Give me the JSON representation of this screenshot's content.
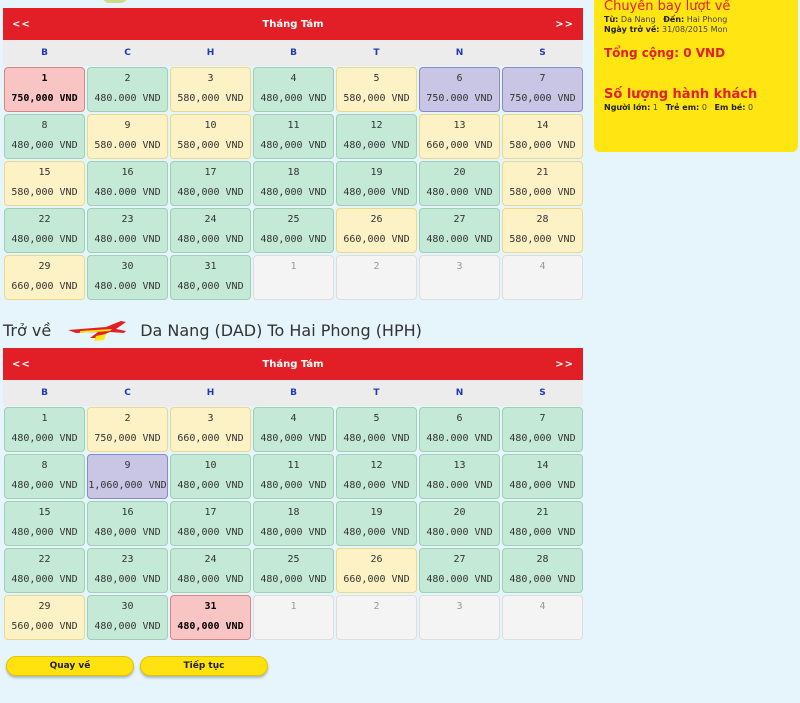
{
  "outbound": {
    "month": "Tháng Tám",
    "prev": "<<",
    "next": ">>",
    "weekdays": [
      "B",
      "C",
      "H",
      "B",
      "T",
      "N",
      "S"
    ],
    "days": [
      {
        "day": "1",
        "price": "750,000 VND",
        "color": "red"
      },
      {
        "day": "2",
        "price": "480.000 VND",
        "color": "green"
      },
      {
        "day": "3",
        "price": "580,000 VND",
        "color": "yellow"
      },
      {
        "day": "4",
        "price": "480,000 VND",
        "color": "green"
      },
      {
        "day": "5",
        "price": "580,000 VND",
        "color": "yellow"
      },
      {
        "day": "6",
        "price": "750.000 VND",
        "color": "purple"
      },
      {
        "day": "7",
        "price": "750,000 VND",
        "color": "purple"
      },
      {
        "day": "8",
        "price": "480,000 VND",
        "color": "green"
      },
      {
        "day": "9",
        "price": "580.000 VND",
        "color": "yellow"
      },
      {
        "day": "10",
        "price": "580,000 VND",
        "color": "yellow"
      },
      {
        "day": "11",
        "price": "480,000 VND",
        "color": "green"
      },
      {
        "day": "12",
        "price": "480,000 VND",
        "color": "green"
      },
      {
        "day": "13",
        "price": "660,000 VND",
        "color": "yellow"
      },
      {
        "day": "14",
        "price": "580,000 VND",
        "color": "yellow"
      },
      {
        "day": "15",
        "price": "580,000 VND",
        "color": "yellow"
      },
      {
        "day": "16",
        "price": "480.000 VND",
        "color": "green"
      },
      {
        "day": "17",
        "price": "480,000 VND",
        "color": "green"
      },
      {
        "day": "18",
        "price": "480,000 VND",
        "color": "green"
      },
      {
        "day": "19",
        "price": "480,000 VND",
        "color": "green"
      },
      {
        "day": "20",
        "price": "480.000 VND",
        "color": "green"
      },
      {
        "day": "21",
        "price": "580,000 VND",
        "color": "yellow"
      },
      {
        "day": "22",
        "price": "480,000 VND",
        "color": "green"
      },
      {
        "day": "23",
        "price": "480.000 VND",
        "color": "green"
      },
      {
        "day": "24",
        "price": "480,000 VND",
        "color": "green"
      },
      {
        "day": "25",
        "price": "480,000 VND",
        "color": "green"
      },
      {
        "day": "26",
        "price": "660,000 VND",
        "color": "yellow"
      },
      {
        "day": "27",
        "price": "480.000 VND",
        "color": "green"
      },
      {
        "day": "28",
        "price": "580,000 VND",
        "color": "yellow"
      },
      {
        "day": "29",
        "price": "660,000 VND",
        "color": "yellow"
      },
      {
        "day": "30",
        "price": "480.000 VND",
        "color": "green"
      },
      {
        "day": "31",
        "price": "480,000 VND",
        "color": "green"
      },
      {
        "day": "1",
        "price": "",
        "color": "empty"
      },
      {
        "day": "2",
        "price": "",
        "color": "empty"
      },
      {
        "day": "3",
        "price": "",
        "color": "empty"
      },
      {
        "day": "4",
        "price": "",
        "color": "empty"
      }
    ]
  },
  "return_route": {
    "label": "Trở về",
    "route": "Da Nang (DAD) To Hai Phong (HPH)"
  },
  "inbound": {
    "month": "Tháng Tám",
    "prev": "<<",
    "next": ">>",
    "weekdays": [
      "B",
      "C",
      "H",
      "B",
      "T",
      "N",
      "S"
    ],
    "days": [
      {
        "day": "1",
        "price": "480,000 VND",
        "color": "green"
      },
      {
        "day": "2",
        "price": "750,000 VND",
        "color": "yellow"
      },
      {
        "day": "3",
        "price": "660,000 VND",
        "color": "yellow"
      },
      {
        "day": "4",
        "price": "480,000 VND",
        "color": "green"
      },
      {
        "day": "5",
        "price": "480,000 VND",
        "color": "green"
      },
      {
        "day": "6",
        "price": "480.000 VND",
        "color": "green"
      },
      {
        "day": "7",
        "price": "480,000 VND",
        "color": "green"
      },
      {
        "day": "8",
        "price": "480,000 VND",
        "color": "green"
      },
      {
        "day": "9",
        "price": "1,060,000 VND",
        "color": "purple"
      },
      {
        "day": "10",
        "price": "480,000 VND",
        "color": "green"
      },
      {
        "day": "11",
        "price": "480,000 VND",
        "color": "green"
      },
      {
        "day": "12",
        "price": "480,000 VND",
        "color": "green"
      },
      {
        "day": "13",
        "price": "480.000 VND",
        "color": "green"
      },
      {
        "day": "14",
        "price": "480,000 VND",
        "color": "green"
      },
      {
        "day": "15",
        "price": "480,000 VND",
        "color": "green"
      },
      {
        "day": "16",
        "price": "480,000 VND",
        "color": "green"
      },
      {
        "day": "17",
        "price": "480,000 VND",
        "color": "green"
      },
      {
        "day": "18",
        "price": "480,000 VND",
        "color": "green"
      },
      {
        "day": "19",
        "price": "480,000 VND",
        "color": "green"
      },
      {
        "day": "20",
        "price": "480.000 VND",
        "color": "green"
      },
      {
        "day": "21",
        "price": "480,000 VND",
        "color": "green"
      },
      {
        "day": "22",
        "price": "480,000 VND",
        "color": "green"
      },
      {
        "day": "23",
        "price": "480,000 VND",
        "color": "green"
      },
      {
        "day": "24",
        "price": "480,000 VND",
        "color": "green"
      },
      {
        "day": "25",
        "price": "480,000 VND",
        "color": "green"
      },
      {
        "day": "26",
        "price": "660,000 VND",
        "color": "yellow"
      },
      {
        "day": "27",
        "price": "480.000 VND",
        "color": "green"
      },
      {
        "day": "28",
        "price": "480,000 VND",
        "color": "green"
      },
      {
        "day": "29",
        "price": "560,000 VND",
        "color": "yellow"
      },
      {
        "day": "30",
        "price": "480,000 VND",
        "color": "green"
      },
      {
        "day": "31",
        "price": "480,000 VND",
        "color": "red"
      },
      {
        "day": "1",
        "price": "",
        "color": "empty"
      },
      {
        "day": "2",
        "price": "",
        "color": "empty"
      },
      {
        "day": "3",
        "price": "",
        "color": "empty"
      },
      {
        "day": "4",
        "price": "",
        "color": "empty"
      }
    ]
  },
  "summary": {
    "title": "Chuyến bay lượt về",
    "from_label": "Từ:",
    "from": "Da Nang",
    "to_label": "Đến:",
    "to": "Hai Phong",
    "date_label": "Ngày trở về:",
    "date": "31/08/2015 Mon",
    "total": "Tổng cộng: 0 VND",
    "pax_title": "Số lượng hành khách",
    "adults_label": "Người lớn:",
    "adults": "1",
    "children_label": "Trẻ em:",
    "children": "0",
    "infants_label": "Em bé:",
    "infants": "0"
  },
  "buttons": {
    "back": "Quay về",
    "next": "Tiếp tục"
  },
  "colors": {
    "brand_red": "#e21f26",
    "brand_yellow": "#ffe512",
    "cell_green": "#c5e9d7",
    "cell_yellow": "#fdf2c6",
    "cell_purple": "#c8c6e4",
    "cell_selected": "#f9c4c4"
  },
  "icons": {
    "airline": "airplane-logo-icon"
  }
}
